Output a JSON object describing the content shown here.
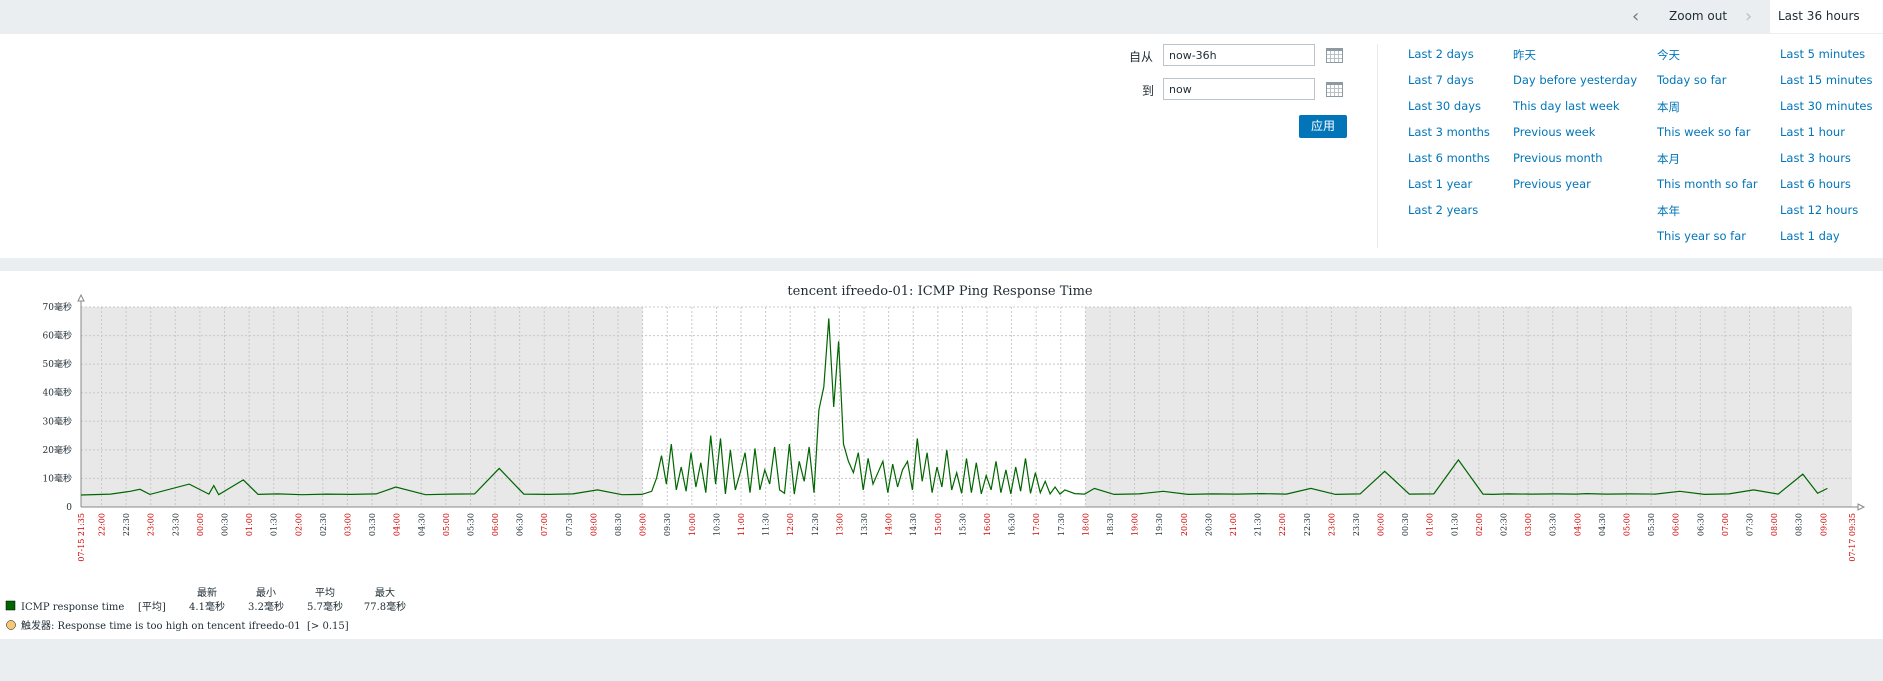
{
  "topbar": {
    "prev_icon": "chevron-left-icon",
    "zoom_out": "Zoom out",
    "next_icon": "chevron-right-icon",
    "active_period": "Last 36 hours",
    "clock_icon": "clock-icon"
  },
  "filter": {
    "from_label": "自从",
    "from_value": "now-36h",
    "to_label": "到",
    "to_value": "now",
    "apply_label": "应用",
    "quick_ranges": [
      [
        "Last 2 days",
        "Last 7 days",
        "Last 30 days",
        "Last 3 months",
        "Last 6 months",
        "Last 1 year",
        "Last 2 years"
      ],
      [
        "昨天",
        "Day before yesterday",
        "This day last week",
        "Previous week",
        "Previous month",
        "Previous year"
      ],
      [
        "今天",
        "Today so far",
        "本周",
        "This week so far",
        "本月",
        "This month so far",
        "本年",
        "This year so far"
      ],
      [
        "Last 5 minutes",
        "Last 15 minutes",
        "Last 30 minutes",
        "Last 1 hour",
        "Last 3 hours",
        "Last 6 hours",
        "Last 12 hours",
        "Last 1 day"
      ]
    ]
  },
  "graph": {
    "colors": {
      "series": "#006600",
      "shade": "#e8e8e8",
      "grid": "#c8c8c8",
      "red_tick": "#d00000",
      "trigger": "#f7c873"
    },
    "legend": {
      "headers": [
        "最新",
        "最小",
        "平均",
        "最大"
      ],
      "series_name": "ICMP response time",
      "series_func": "[平均]",
      "series_values": [
        "4.1毫秒",
        "3.2毫秒",
        "5.7毫秒",
        "77.8毫秒"
      ],
      "trigger_text": "触发器: Response time is too high on tencent ifreedo-01",
      "trigger_cond": "[> 0.15]"
    }
  },
  "chart_data": {
    "type": "line",
    "title": "tencent ifreedo-01: ICMP Ping Response Time",
    "ylabel": "",
    "y_unit": "毫秒",
    "ylim": [
      0,
      70
    ],
    "y_ticks": [
      0,
      10,
      20,
      30,
      40,
      50,
      60,
      70
    ],
    "y_tick_labels": [
      "0",
      "10毫秒",
      "20毫秒",
      "30毫秒",
      "40毫秒",
      "50毫秒",
      "60毫秒",
      "70毫秒"
    ],
    "x_start_label": "07-15 21:35",
    "x_end_label": "07-17 09:35",
    "x_tick_labels": [
      "22:00",
      "22:30",
      "23:00",
      "23:30",
      "00:00",
      "00:30",
      "01:00",
      "01:30",
      "02:00",
      "02:30",
      "03:00",
      "03:30",
      "04:00",
      "04:30",
      "05:00",
      "05:30",
      "06:00",
      "06:30",
      "07:00",
      "07:30",
      "08:00",
      "08:30",
      "09:00",
      "09:30",
      "10:00",
      "10:30",
      "11:00",
      "11:30",
      "12:00",
      "12:30",
      "13:00",
      "13:30",
      "14:00",
      "14:30",
      "15:00",
      "15:30",
      "16:00",
      "16:30",
      "17:00",
      "17:30",
      "18:00",
      "18:30",
      "19:00",
      "19:30",
      "20:00",
      "20:30",
      "21:00",
      "21:30",
      "22:00",
      "22:30",
      "23:00",
      "23:30",
      "00:00",
      "00:30",
      "01:00",
      "01:30",
      "02:00",
      "02:30",
      "03:00",
      "03:30",
      "04:00",
      "04:30",
      "05:00",
      "05:30",
      "06:00",
      "06:30",
      "07:00",
      "07:30",
      "08:00",
      "08:30",
      "09:00"
    ],
    "x_tick_hours": [
      0.4167,
      0.9167,
      1.4167,
      1.9167,
      2.4167,
      2.9167,
      3.4167,
      3.9167,
      4.4167,
      4.9167,
      5.4167,
      5.9167,
      6.4167,
      6.9167,
      7.4167,
      7.9167,
      8.4167,
      8.9167,
      9.4167,
      9.9167,
      10.4167,
      10.9167,
      11.4167,
      11.9167,
      12.4167,
      12.9167,
      13.4167,
      13.9167,
      14.4167,
      14.9167,
      15.4167,
      15.9167,
      16.4167,
      16.9167,
      17.4167,
      17.9167,
      18.4167,
      18.9167,
      19.4167,
      19.9167,
      20.4167,
      20.9167,
      21.4167,
      21.9167,
      22.4167,
      22.9167,
      23.4167,
      23.9167,
      24.4167,
      24.9167,
      25.4167,
      25.9167,
      26.4167,
      26.9167,
      27.4167,
      27.9167,
      28.4167,
      28.9167,
      29.4167,
      29.9167,
      30.4167,
      30.9167,
      31.4167,
      31.9167,
      32.4167,
      32.9167,
      33.4167,
      33.9167,
      34.4167,
      34.9167,
      35.4167
    ],
    "x_range_hours": [
      0,
      36
    ],
    "working_time_hours": [
      [
        11.4167,
        20.4167
      ]
    ],
    "series": [
      {
        "name": "ICMP response time",
        "x_hours": [
          0,
          0.6,
          1.0,
          1.2,
          1.4,
          2.2,
          2.6,
          2.7,
          2.8,
          3.3,
          3.6,
          4.0,
          4.5,
          5.0,
          5.5,
          6.0,
          6.4,
          7.0,
          7.5,
          8.0,
          8.5,
          9.0,
          9.5,
          10.0,
          10.5,
          11.0,
          11.4,
          11.6,
          11.7,
          11.8,
          11.9,
          12.0,
          12.1,
          12.2,
          12.3,
          12.4,
          12.5,
          12.6,
          12.7,
          12.8,
          12.9,
          13.0,
          13.1,
          13.2,
          13.3,
          13.4,
          13.5,
          13.6,
          13.7,
          13.8,
          13.9,
          14.0,
          14.1,
          14.2,
          14.3,
          14.4,
          14.5,
          14.6,
          14.7,
          14.8,
          14.9,
          15.0,
          15.1,
          15.2,
          15.3,
          15.4,
          15.5,
          15.6,
          15.7,
          15.8,
          15.9,
          16.0,
          16.1,
          16.2,
          16.3,
          16.4,
          16.5,
          16.6,
          16.7,
          16.8,
          16.9,
          17.0,
          17.1,
          17.2,
          17.3,
          17.4,
          17.5,
          17.6,
          17.7,
          17.8,
          17.9,
          18.0,
          18.1,
          18.2,
          18.3,
          18.4,
          18.5,
          18.6,
          18.7,
          18.8,
          18.9,
          19.0,
          19.1,
          19.2,
          19.3,
          19.4,
          19.5,
          19.6,
          19.7,
          19.8,
          19.9,
          20.0,
          20.2,
          20.4,
          20.6,
          21.0,
          21.5,
          22.0,
          22.5,
          23.0,
          23.5,
          24.0,
          24.5,
          25.0,
          25.5,
          26.0,
          26.5,
          27.0,
          27.5,
          28.0,
          28.5,
          28.7,
          29.0,
          29.5,
          30.0,
          30.4,
          30.6,
          31.0,
          31.5,
          32.0,
          32.5,
          33.0,
          33.5,
          34.0,
          34.5,
          35.0,
          35.3,
          35.5,
          35.7,
          36.0
        ],
        "y": [
          4.2,
          4.5,
          5.5,
          6.2,
          4.4,
          8.0,
          4.5,
          7.5,
          4.3,
          9.5,
          4.4,
          4.6,
          4.3,
          4.5,
          4.4,
          4.6,
          7.0,
          4.3,
          4.5,
          4.6,
          13.5,
          4.5,
          4.4,
          4.6,
          6.0,
          4.3,
          4.4,
          5.5,
          10.2,
          18.0,
          8.0,
          22.0,
          6.0,
          14.0,
          5.5,
          19.0,
          7.0,
          15.5,
          5.0,
          25.0,
          8.0,
          24.0,
          4.6,
          20.0,
          6.0,
          12.0,
          19.0,
          5.0,
          20.5,
          6.0,
          13.0,
          8.0,
          21.0,
          6.0,
          4.8,
          22.0,
          4.5,
          16.0,
          9.0,
          21.0,
          5.0,
          34.0,
          42.0,
          66.0,
          35.0,
          58.0,
          22.0,
          16.0,
          12.0,
          19.0,
          6.0,
          17.0,
          8.0,
          12.0,
          16.0,
          5.0,
          15.0,
          7.0,
          13.0,
          16.0,
          6.0,
          24.0,
          9.0,
          19.0,
          5.0,
          14.0,
          7.0,
          20.0,
          6.0,
          12.0,
          4.8,
          17.0,
          5.0,
          15.5,
          4.6,
          11.0,
          6.0,
          16.0,
          5.0,
          13.0,
          4.6,
          14.0,
          5.5,
          17.0,
          4.8,
          12.0,
          5.0,
          9.0,
          4.6,
          7.0,
          4.5,
          6.0,
          4.7,
          4.5,
          6.5,
          4.4,
          4.6,
          5.5,
          4.4,
          4.6,
          4.5,
          4.7,
          4.5,
          6.5,
          4.4,
          4.6,
          12.5,
          4.5,
          4.6,
          16.5,
          4.5,
          4.4,
          4.6,
          4.5,
          4.6,
          4.5,
          4.7,
          4.5,
          4.6,
          4.5,
          5.5,
          4.4,
          4.6,
          6.0,
          4.5,
          11.5,
          4.8,
          6.5
        ]
      }
    ]
  }
}
